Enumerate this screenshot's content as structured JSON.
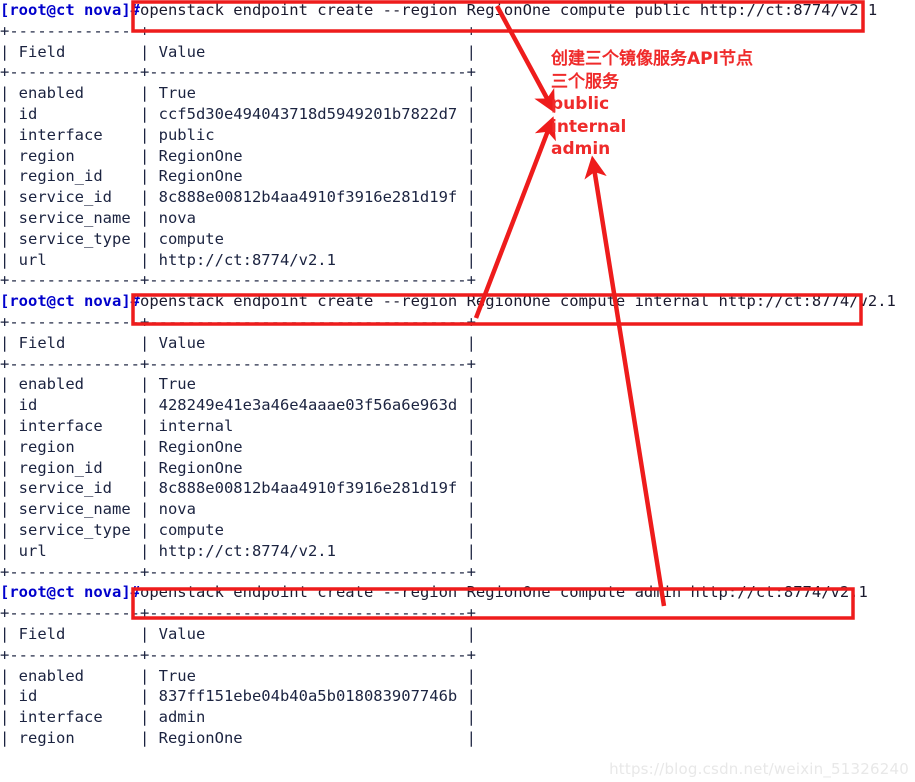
{
  "terminal": {
    "prompt": "[root@ct nova]#",
    "prompt_color": "#0000cc",
    "text_color": "#1a1a2e",
    "background": "#ffffff",
    "blocks": [
      {
        "id": "block-public",
        "command": "openstack endpoint create --region RegionOne compute public http://ct:8774/v2.1",
        "table": {
          "headers": [
            "Field",
            "Value"
          ],
          "rows": [
            [
              "enabled",
              "True"
            ],
            [
              "id",
              "ccf5d30e494043718d5949201b7822d7"
            ],
            [
              "interface",
              "public"
            ],
            [
              "region",
              "RegionOne"
            ],
            [
              "region_id",
              "RegionOne"
            ],
            [
              "service_id",
              "8c888e00812b4aa4910f3916e281d19f"
            ],
            [
              "service_name",
              "nova"
            ],
            [
              "service_type",
              "compute"
            ],
            [
              "url",
              "http://ct:8774/v2.1"
            ]
          ]
        }
      },
      {
        "id": "block-internal",
        "command": "openstack endpoint create --region RegionOne compute internal http://ct:8774/v2.1",
        "table": {
          "headers": [
            "Field",
            "Value"
          ],
          "rows": [
            [
              "enabled",
              "True"
            ],
            [
              "id",
              "428249e41e3a46e4aaae03f56a6e963d"
            ],
            [
              "interface",
              "internal"
            ],
            [
              "region",
              "RegionOne"
            ],
            [
              "region_id",
              "RegionOne"
            ],
            [
              "service_id",
              "8c888e00812b4aa4910f3916e281d19f"
            ],
            [
              "service_name",
              "nova"
            ],
            [
              "service_type",
              "compute"
            ],
            [
              "url",
              "http://ct:8774/v2.1"
            ]
          ]
        }
      },
      {
        "id": "block-admin",
        "command": "openstack endpoint create --region RegionOne compute admin http://ct:8774/v2.1",
        "table": {
          "headers": [
            "Field",
            "Value"
          ],
          "rows": [
            [
              "enabled",
              "True"
            ],
            [
              "id",
              "837ff151ebe04b40a5b018083907746b"
            ],
            [
              "interface",
              "admin"
            ],
            [
              "region",
              "RegionOne"
            ]
          ]
        }
      }
    ]
  },
  "annotation": {
    "color": "#ef2b2b",
    "highlight_color": "#ee1c1c",
    "lines": [
      "创建三个镜像服务API节点",
      "三个服务",
      "public",
      "internal",
      "admin"
    ]
  },
  "watermark": {
    "text": "https://blog.csdn.net/weixin_51326240",
    "color": "#e8e8e8"
  }
}
